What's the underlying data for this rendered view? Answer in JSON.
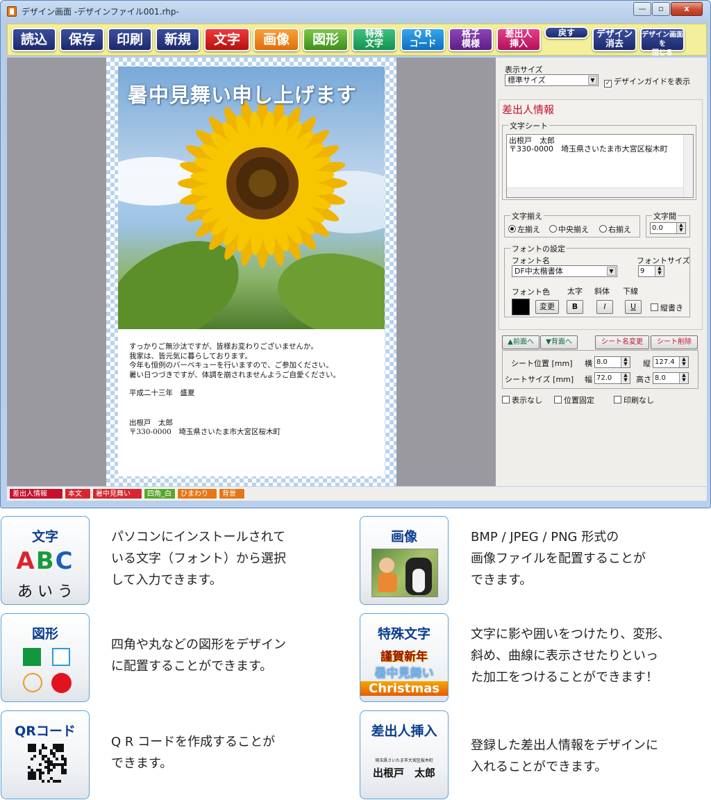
{
  "window": {
    "title": "デザイン画面 -デザインファイル001.rhp-",
    "minimize": "—",
    "maximize": "▫",
    "close": "x"
  },
  "toolbar": {
    "read": "読込",
    "save": "保存",
    "print": "印刷",
    "new": "新規",
    "text": "文字",
    "image": "画像",
    "shape": "図形",
    "special_1": "特殊",
    "special_2": "文字",
    "qr_1": "Q R",
    "qr_2": "コード",
    "grid_1": "格子",
    "grid_2": "模様",
    "sender_1": "差出人",
    "sender_2": "挿入",
    "back": "戻す",
    "clear_1": "デザイン",
    "clear_2": "消去",
    "close_1": "デザイン画面を",
    "close_2": "閉じる"
  },
  "canvas": {
    "headline": "暑中見舞い申し上げます",
    "body_lines": [
      "すっかりご無沙汰ですが、皆様お変わりございませんか。",
      "我家は、皆元気に暮らしております。",
      "今年も恒例のバーベキューを行いますので、ご参加ください。",
      "暑い日つづきですが、体調を崩されませんようご自愛ください。"
    ],
    "date": "平成二十三年　盛夏",
    "sender_name": "出根戸　太郎",
    "sender_address": "〒330-0000　埼玉県さいたま市大宮区桜木町"
  },
  "panel": {
    "display_size_label": "表示サイズ",
    "display_size_value": "標準サイズ",
    "design_guide_label": "デザインガイドを表示",
    "design_guide_checked": true,
    "section_title": "差出人情報",
    "text_sheet_label": "文字シート",
    "text_sheet_lines": [
      "出根戸　太郎",
      "〒330-0000　埼玉県さいたま市大宮区桜木町"
    ],
    "align_group": "文字揃え",
    "align_left": "左揃え",
    "align_center": "中央揃え",
    "align_right": "右揃え",
    "spacing_group": "文字間",
    "spacing_value": "0.0",
    "font_group": "フォントの設定",
    "font_name_label": "フォント名",
    "font_name_value": "DF中太楷書体",
    "font_size_label": "フォントサイズ",
    "font_size_value": "9",
    "font_color_label": "フォント色",
    "bold_label": "太字",
    "italic_label": "斜体",
    "underline_label": "下線",
    "change_button": "変更",
    "bold_button": "B",
    "italic_button": "I",
    "underline_button": "U",
    "vertical_label": "縦書き",
    "front_button": "▲前面へ",
    "back_button": "▼背面へ",
    "rename_button": "シート名変更",
    "delete_button": "シート削除",
    "pos_label": "シート位置 [mm]",
    "pos_x_label": "横",
    "pos_x_value": "8.0",
    "pos_y_label": "縦",
    "pos_y_value": "127.4",
    "size_label": "シートサイズ [mm]",
    "width_label": "幅",
    "width_value": "72.0",
    "height_label": "高さ",
    "height_value": "8.0",
    "hide_label": "表示なし",
    "lock_label": "位置固定",
    "noprint_label": "印刷なし"
  },
  "tabs": [
    {
      "label": "差出人情報",
      "color": "#c8102e"
    },
    {
      "label": "本文",
      "color": "#d8262e"
    },
    {
      "label": "暑中見舞い",
      "color": "#d8262e"
    },
    {
      "label": "四角_白",
      "color": "#58a72c"
    },
    {
      "label": "ひまわり",
      "color": "#e67716"
    },
    {
      "label": "背景",
      "color": "#e67716"
    }
  ],
  "features": {
    "text": {
      "title": "文字",
      "abc": [
        "A",
        "B",
        "C"
      ],
      "kana": "あ い う",
      "desc_lines": [
        "パソコンにインストールされて",
        "いる文字（フォント）から選択",
        "して入力できます。"
      ]
    },
    "image": {
      "title": "画像",
      "desc_lines": [
        "BMP / JPEG / PNG 形式の",
        "画像ファイルを配置することが",
        "できます。"
      ]
    },
    "shape": {
      "title": "図形",
      "desc_lines": [
        "四角や丸などの図形をデザイン",
        "に配置することができます。"
      ]
    },
    "special": {
      "title": "特殊文字",
      "sample_1": "謹賀新年",
      "sample_2": "暑中見舞い",
      "sample_3": "Christmas",
      "desc_lines": [
        "文字に影や囲いをつけたり、変形、",
        "斜め、曲線に表示させたりといっ",
        "た加工をつけることができます！"
      ]
    },
    "qr": {
      "title": "QRコード",
      "desc_lines": [
        "Q R コードを作成することが",
        "できます。"
      ]
    },
    "sender": {
      "title": "差出人挿入",
      "address": "埼玉県さいたま市大宮区桜木町",
      "name": "出根戸　太郎",
      "desc_lines": [
        "登録した差出人情報をデザインに",
        "入れることができます。"
      ]
    }
  }
}
